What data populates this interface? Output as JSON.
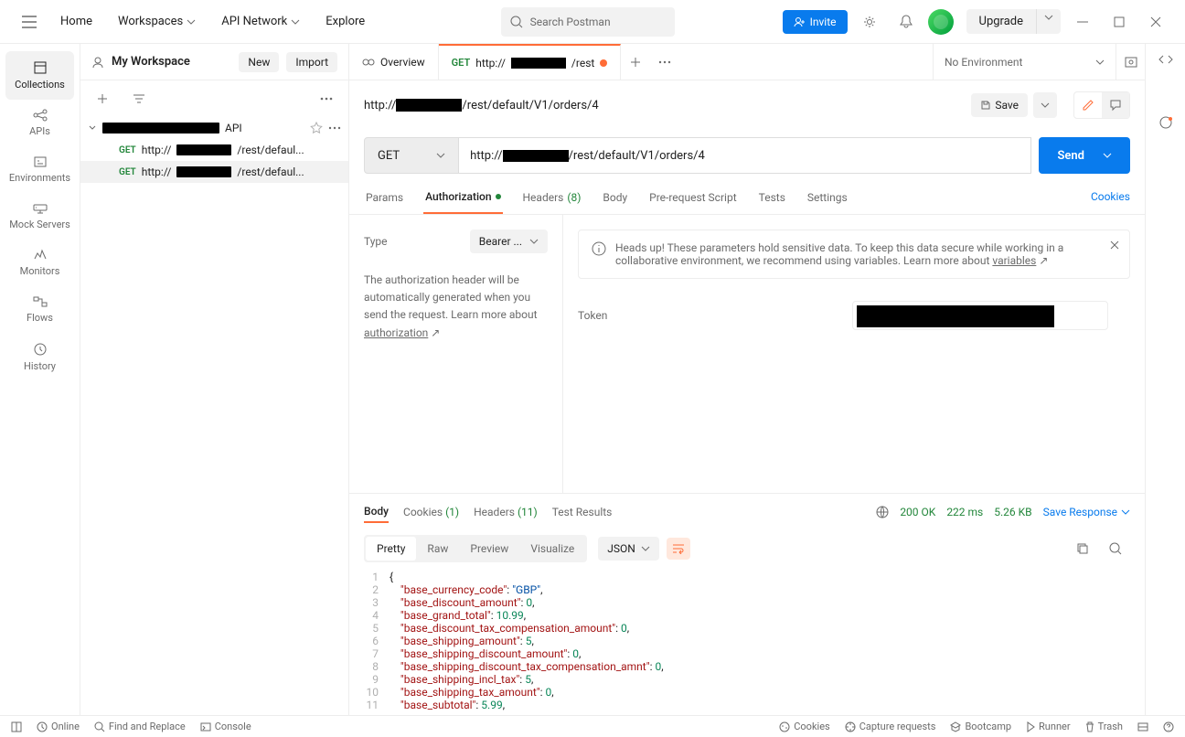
{
  "topnav": {
    "home": "Home",
    "workspaces": "Workspaces",
    "api_network": "API Network",
    "explore": "Explore",
    "search_placeholder": "Search Postman",
    "invite": "Invite",
    "upgrade": "Upgrade"
  },
  "rail": {
    "collections": "Collections",
    "apis": "APIs",
    "environments": "Environments",
    "mock": "Mock Servers",
    "monitors": "Monitors",
    "flows": "Flows",
    "history": "History"
  },
  "workspace": {
    "title": "My Workspace",
    "new": "New",
    "import": "Import"
  },
  "tree": {
    "coll_suffix": "API",
    "m1": "GET",
    "r1_pre": "http://",
    "r1_post": "/rest/defaul...",
    "m2": "GET",
    "r2_pre": "http://",
    "r2_post": "/rest/defaul..."
  },
  "tabs": {
    "overview": "Overview",
    "t2_method": "GET",
    "t2_pre": "http://",
    "t2_post": "/rest",
    "no_env": "No Environment"
  },
  "request": {
    "title_pre": "http://",
    "title_post": "/rest/default/V1/orders/4",
    "save": "Save",
    "method": "GET",
    "url_pre": "http://",
    "url_post": "/rest/default/V1/orders/4",
    "send": "Send"
  },
  "req_tabs": {
    "params": "Params",
    "auth": "Authorization",
    "headers": "Headers",
    "headers_cnt": "(8)",
    "body": "Body",
    "prereq": "Pre-request Script",
    "tests": "Tests",
    "settings": "Settings",
    "cookies": "Cookies"
  },
  "auth": {
    "type_label": "Type",
    "type_value": "Bearer ...",
    "desc1": "The authorization header will be automatically generated when you send the request. Learn more about ",
    "desc_link": "authorization",
    "info": "Heads up! These parameters hold sensitive data. To keep this data secure while working in a collaborative environment, we recommend using variables. Learn more about ",
    "info_link": "variables",
    "token_label": "Token"
  },
  "resp_tabs": {
    "body": "Body",
    "cookies": "Cookies",
    "cookies_cnt": "(1)",
    "headers": "Headers",
    "headers_cnt": "(11)",
    "test": "Test Results"
  },
  "resp_stat": {
    "status": "200 OK",
    "time": "222 ms",
    "size": "5.26 KB",
    "save": "Save Response"
  },
  "view": {
    "pretty": "Pretty",
    "raw": "Raw",
    "preview": "Preview",
    "visualize": "Visualize",
    "format": "JSON"
  },
  "code_lines": [
    {
      "n": "1",
      "h": "<span class='p'>{</span>"
    },
    {
      "n": "2",
      "h": "    <span class='k'>\"base_currency_code\"</span><span class='p'>: </span><span class='s'>\"GBP\"</span><span class='p'>,</span>"
    },
    {
      "n": "3",
      "h": "    <span class='k'>\"base_discount_amount\"</span><span class='p'>: </span><span class='n'>0</span><span class='p'>,</span>"
    },
    {
      "n": "4",
      "h": "    <span class='k'>\"base_grand_total\"</span><span class='p'>: </span><span class='n'>10.99</span><span class='p'>,</span>"
    },
    {
      "n": "5",
      "h": "    <span class='k'>\"base_discount_tax_compensation_amount\"</span><span class='p'>: </span><span class='n'>0</span><span class='p'>,</span>"
    },
    {
      "n": "6",
      "h": "    <span class='k'>\"base_shipping_amount\"</span><span class='p'>: </span><span class='n'>5</span><span class='p'>,</span>"
    },
    {
      "n": "7",
      "h": "    <span class='k'>\"base_shipping_discount_amount\"</span><span class='p'>: </span><span class='n'>0</span><span class='p'>,</span>"
    },
    {
      "n": "8",
      "h": "    <span class='k'>\"base_shipping_discount_tax_compensation_amnt\"</span><span class='p'>: </span><span class='n'>0</span><span class='p'>,</span>"
    },
    {
      "n": "9",
      "h": "    <span class='k'>\"base_shipping_incl_tax\"</span><span class='p'>: </span><span class='n'>5</span><span class='p'>,</span>"
    },
    {
      "n": "10",
      "h": "    <span class='k'>\"base_shipping_tax_amount\"</span><span class='p'>: </span><span class='n'>0</span><span class='p'>,</span>"
    },
    {
      "n": "11",
      "h": "    <span class='k'>\"base_subtotal\"</span><span class='p'>: </span><span class='n'>5.99</span><span class='p'>,</span>"
    }
  ],
  "footer": {
    "online": "Online",
    "find": "Find and Replace",
    "console": "Console",
    "cookies": "Cookies",
    "capture": "Capture requests",
    "bootcamp": "Bootcamp",
    "runner": "Runner",
    "trash": "Trash"
  }
}
